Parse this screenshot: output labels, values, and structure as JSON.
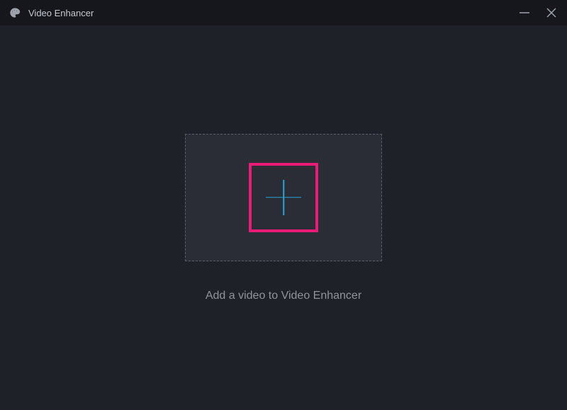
{
  "titlebar": {
    "app_name": "Video Enhancer"
  },
  "main": {
    "drop_label": "Add a video to Video Enhancer"
  },
  "icons": {
    "app": "palette-icon",
    "minimize": "minimize-icon",
    "close": "close-icon",
    "plus": "plus-icon"
  },
  "colors": {
    "highlight": "#ea1b74",
    "plus_stroke": "#2aa3d4",
    "bg_main": "#1e2128",
    "bg_titlebar": "#15171c",
    "bg_dropzone": "#2a2d35"
  }
}
